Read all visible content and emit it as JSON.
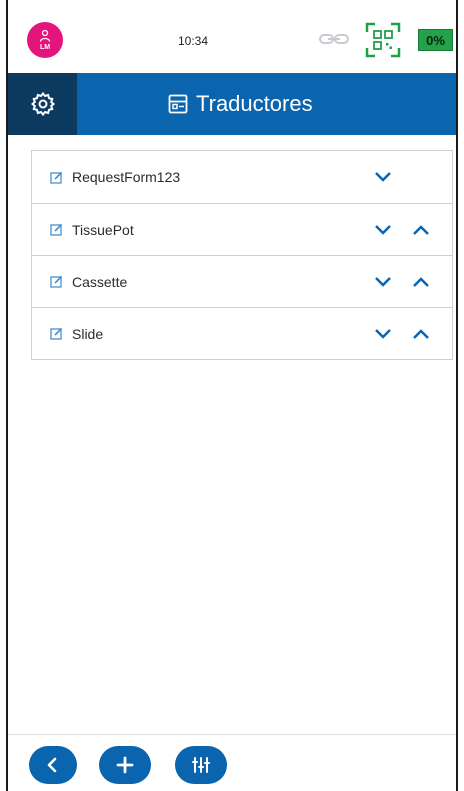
{
  "status_bar": {
    "avatar_initials": "LM",
    "time": "10:34",
    "battery": "0%",
    "icons": [
      "user-icon",
      "link-icon",
      "qr-code-icon"
    ]
  },
  "header": {
    "title": "Traductores",
    "icons": [
      "settings-gear-icon",
      "list-panel-icon"
    ]
  },
  "items": [
    {
      "label": "RequestForm123",
      "buttons": [
        "move-down"
      ]
    },
    {
      "label": "TissuePot",
      "buttons": [
        "move-down",
        "move-up"
      ]
    },
    {
      "label": "Cassette",
      "buttons": [
        "move-down",
        "move-up"
      ]
    },
    {
      "label": "Slide",
      "buttons": [
        "move-down",
        "move-up"
      ]
    }
  ],
  "bottom_bar": {
    "buttons": [
      "back-icon",
      "plus-icon",
      "sliders-icon"
    ]
  },
  "colors": {
    "primary": "#0a64ae",
    "header_dark": "#0c3a60",
    "avatar": "#e3147b",
    "battery": "#22a24a",
    "qr": "#1fa04a"
  }
}
